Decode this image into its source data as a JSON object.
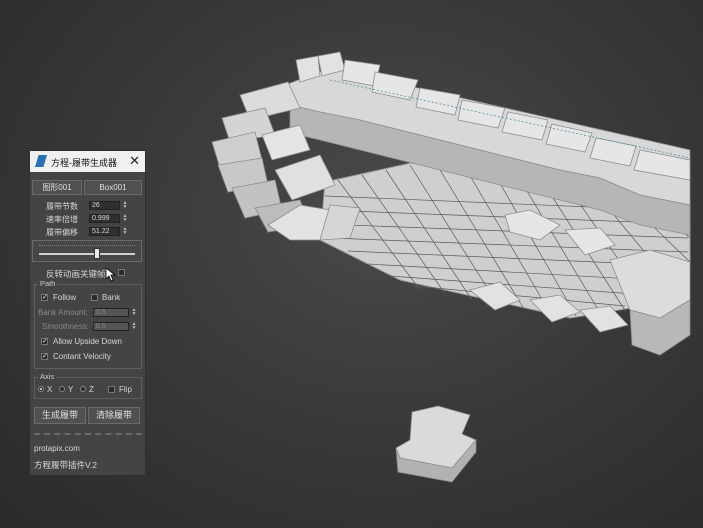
{
  "colors": {
    "track_face": "#dcdcdc",
    "track_side": "#b4b4b4",
    "grid_line": "#3e3e3e",
    "panel_bg": "#444444"
  },
  "panel": {
    "title": "方程-履带生成器",
    "close_glyph": "✕",
    "shape_button": "图形001",
    "box_button": "Box001",
    "segments_label": "履带节数",
    "segments_value": "26",
    "speed_label": "速率倍增",
    "speed_value": "0.999",
    "offset_label": "履带偏移",
    "offset_value": "51.22",
    "slider_level": 0.6,
    "reverse_label": "反转动画关键帧",
    "path_group": "Path",
    "follow_label": "Follow",
    "bank_label": "Bank",
    "bank_amount_label": "Bank Amount:",
    "bank_amount_value": "0.5",
    "smoothness_label": "Smoothness:",
    "smoothness_value": "0.5",
    "upside_label": "Allow Upside Down",
    "velocity_label": "Contant Velocity",
    "axis_group": "Axis",
    "axis_x": "X",
    "axis_y": "Y",
    "axis_z": "Z",
    "flip_label": "Flip",
    "generate_button": "生成履带",
    "clear_button": "清除履带",
    "website": "protapix.com",
    "plugin_version": "方程履带插件V.2"
  }
}
